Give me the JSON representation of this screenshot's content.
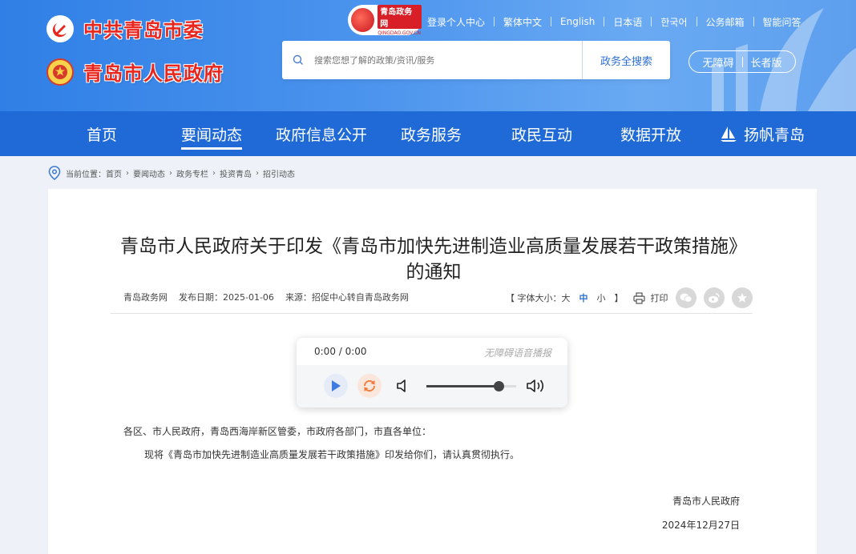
{
  "header": {
    "party_title": "中共青岛市委",
    "gov_title": "青岛市人民政府",
    "brand": {
      "name": "青岛政务网",
      "domain": "QINGDAO.GOV.CN"
    },
    "top_links": [
      "登录个人中心",
      "繁体中文",
      "English",
      "日本语",
      "한국어",
      "公务邮箱",
      "智能问答"
    ],
    "search": {
      "placeholder": "搜索您想了解的政策/资讯/服务",
      "button": "政务全搜索"
    },
    "access": {
      "accessible": "无障碍",
      "elderly": "长者版"
    }
  },
  "nav": {
    "items": [
      "首页",
      "要闻动态",
      "政府信息公开",
      "政务服务",
      "政民互动",
      "数据开放",
      "扬帆青岛"
    ],
    "active_index": 1
  },
  "breadcrumb": {
    "prefix": "当前位置：",
    "items": [
      "首页",
      "要闻动态",
      "政务专栏",
      "投资青岛",
      "招引动态"
    ]
  },
  "article": {
    "title": "青岛市人民政府关于印发《青岛市加快先进制造业高质量发展若干政策措施》的通知",
    "site": "青岛政务网",
    "date": "发布日期：2025-01-06",
    "source": "来源：招促中心转自青岛政务网",
    "font_size": {
      "label": "【 字体大小：",
      "large": "大",
      "medium": "中",
      "small": "小",
      "close": "】",
      "current": "中"
    },
    "print": "打印",
    "share_icons": [
      "wechat-icon",
      "weibo-icon",
      "favorite-icon"
    ],
    "salutation": "各区、市人民政府，青岛西海岸新区管委，市政府各部门，市直各单位：",
    "paragraph": "现将《青岛市加快先进制造业高质量发展若干政策措施》印发给你们，请认真贯彻执行。",
    "signature": "青岛市人民政府",
    "sign_date": "2024年12月27日"
  },
  "player": {
    "time": "0:00 / 0:00",
    "label": "无障碍语音播报",
    "volume": 0.8
  },
  "colors": {
    "nav": "#1f6ad6",
    "accent": "#2d6fd1",
    "brand_red": "#e8261e"
  }
}
